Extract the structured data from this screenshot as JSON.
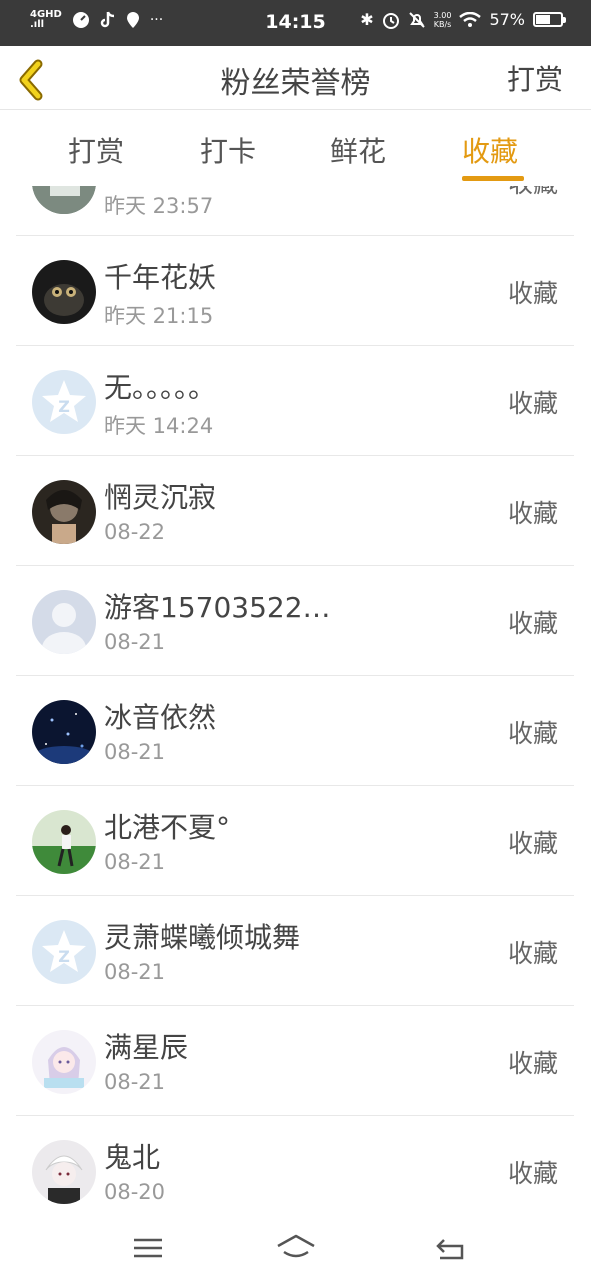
{
  "status": {
    "network": "4GHD",
    "signal": ".ıll",
    "time": "14:15",
    "speed_top": "3.00",
    "speed_bottom": "KB/s",
    "battery": "57%"
  },
  "header": {
    "title": "粉丝荣誉榜",
    "action": "打赏"
  },
  "tabs": [
    {
      "label": "打赏"
    },
    {
      "label": "打卡"
    },
    {
      "label": "鲜花"
    },
    {
      "label": "收藏"
    }
  ],
  "list": [
    {
      "name": "",
      "time": "昨天 23:57",
      "action": "收藏"
    },
    {
      "name": "千年花妖",
      "time": "昨天 21:15",
      "action": "收藏"
    },
    {
      "name": "无。。。。。",
      "time": "昨天 14:24",
      "action": "收藏"
    },
    {
      "name": "惘灵沉寂",
      "time": "08-22",
      "action": "收藏"
    },
    {
      "name": "游客15703522…",
      "time": "08-21",
      "action": "收藏"
    },
    {
      "name": "冰音依然",
      "time": "08-21",
      "action": "收藏"
    },
    {
      "name": "北港不夏°",
      "time": "08-21",
      "action": "收藏"
    },
    {
      "name": "灵萧蝶曦倾城舞",
      "time": "08-21",
      "action": "收藏"
    },
    {
      "name": "满星辰",
      "time": "08-21",
      "action": "收藏"
    },
    {
      "name": "鬼北",
      "time": "08-20",
      "action": "收藏"
    }
  ],
  "colors": {
    "accent": "#e39a12",
    "statusbar": "#3a3a3a"
  }
}
